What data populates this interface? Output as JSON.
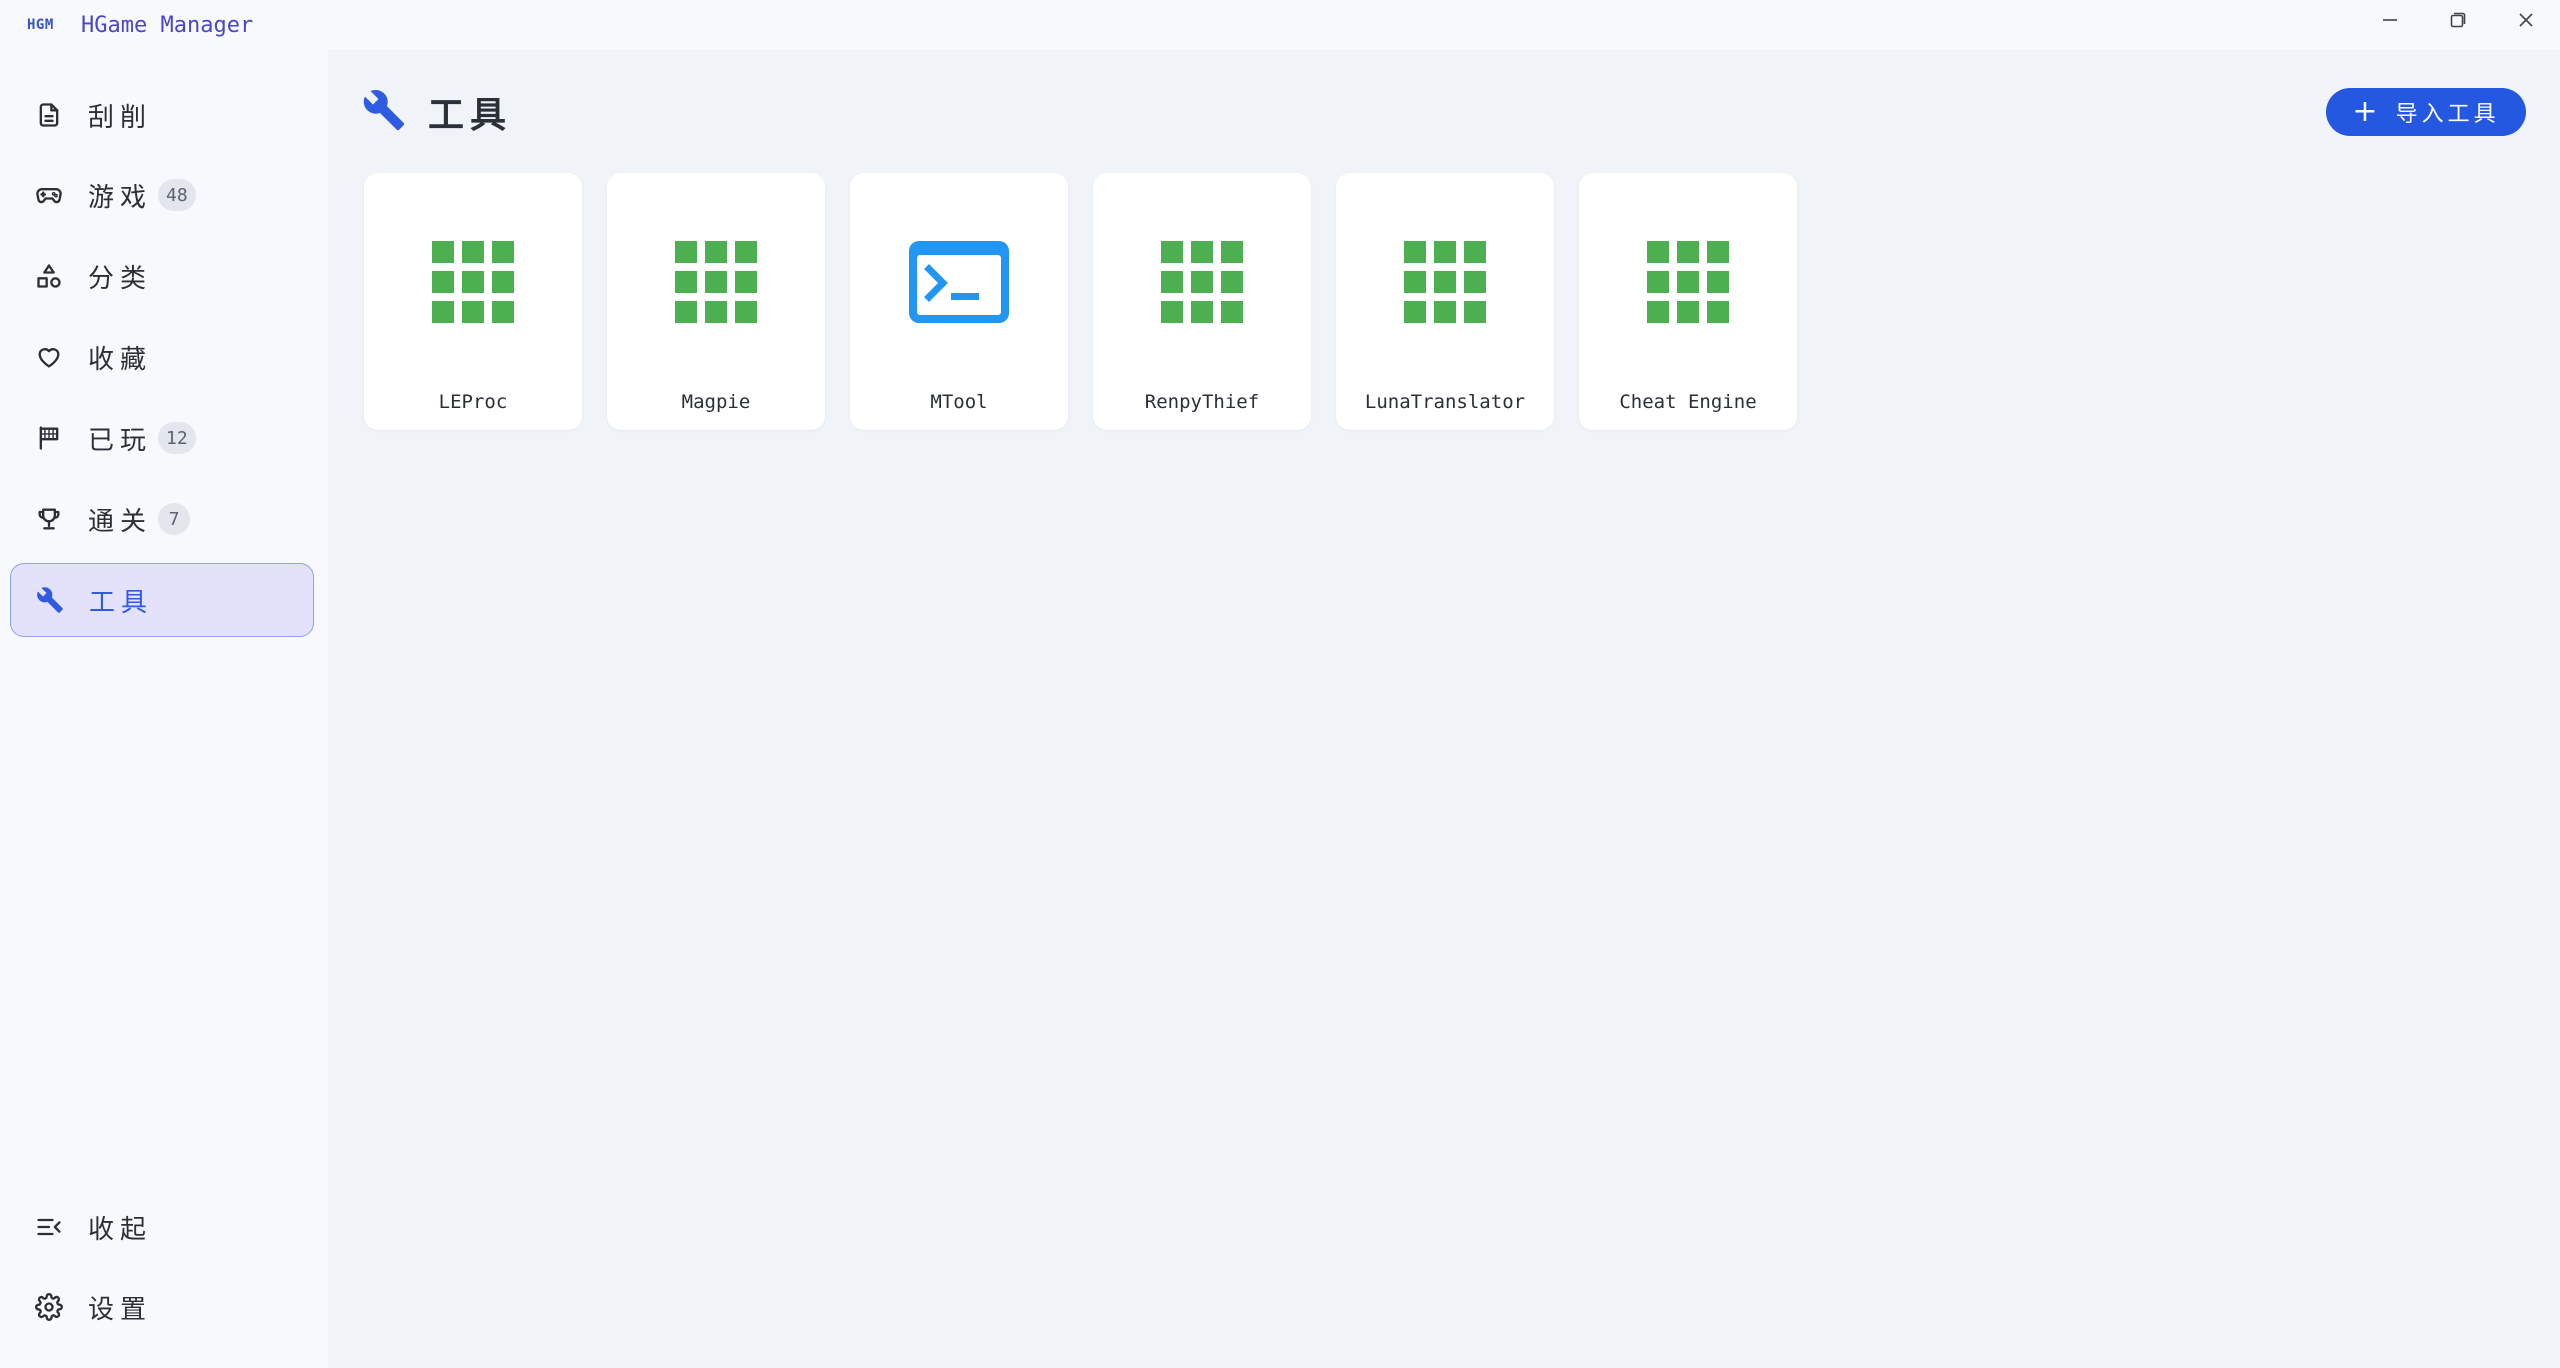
{
  "app": {
    "logo_text": "HGM",
    "title": "HGame Manager"
  },
  "sidebar": {
    "items": [
      {
        "label": "刮削",
        "icon": "document-icon"
      },
      {
        "label": "游戏",
        "icon": "gamepad-icon",
        "badge": "48"
      },
      {
        "label": "分类",
        "icon": "shapes-icon"
      },
      {
        "label": "收藏",
        "icon": "heart-icon"
      },
      {
        "label": "已玩",
        "icon": "flag-icon",
        "badge": "12"
      },
      {
        "label": "通关",
        "icon": "trophy-icon",
        "badge": "7"
      },
      {
        "label": "工具",
        "icon": "wrench-icon",
        "active": true
      }
    ],
    "bottom": [
      {
        "label": "收起",
        "icon": "collapse-icon"
      },
      {
        "label": "设置",
        "icon": "gear-icon"
      }
    ]
  },
  "main": {
    "title": "工具",
    "import_button": "导入工具",
    "tools": [
      {
        "name": "LEProc",
        "icon": "grid-icon"
      },
      {
        "name": "Magpie",
        "icon": "grid-icon"
      },
      {
        "name": "MTool",
        "icon": "terminal-icon"
      },
      {
        "name": "RenpyThief",
        "icon": "grid-icon"
      },
      {
        "name": "LunaTranslator",
        "icon": "grid-icon"
      },
      {
        "name": "Cheat Engine",
        "icon": "grid-icon"
      }
    ]
  },
  "colors": {
    "accent": "#2458e0",
    "grid_icon": "#4caf50",
    "terminal_icon": "#2196f3",
    "active_bg": "#e4e1fa"
  }
}
